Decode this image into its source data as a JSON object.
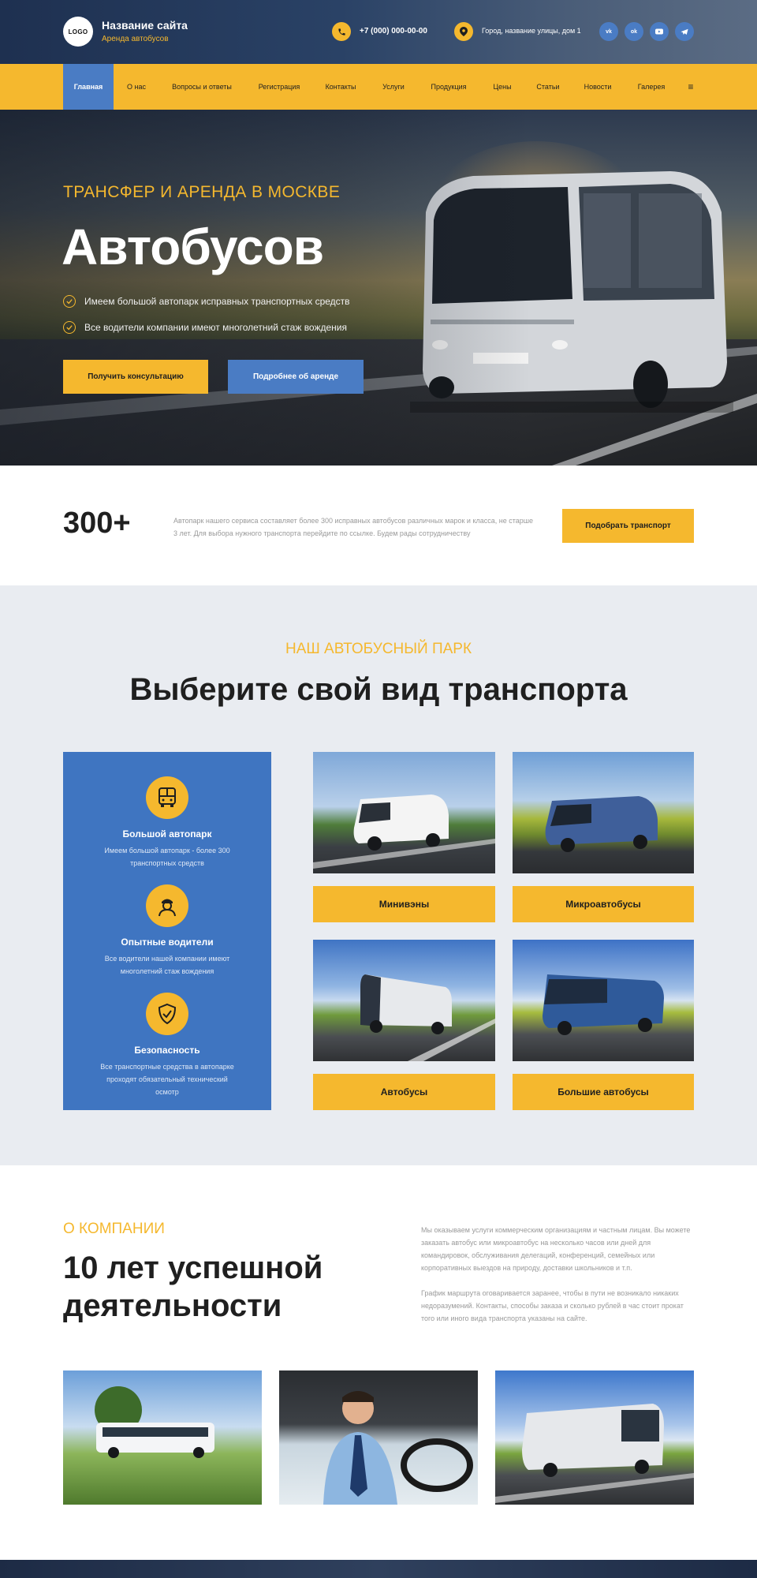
{
  "header": {
    "logo_text": "LOGO",
    "site_name": "Название сайта",
    "tagline": "Аренда автобусов",
    "phone": "+7 (000) 000-00-00",
    "address": "Город, название улицы, дом 1",
    "socials": [
      {
        "label": "vk",
        "icon": "vk-icon"
      },
      {
        "label": "ok",
        "icon": "odnoklassniki-icon"
      },
      {
        "label": "yt",
        "icon": "youtube-icon"
      },
      {
        "label": "tg",
        "icon": "telegram-icon"
      }
    ],
    "accent_color": "#f5b82e",
    "brand_blue": "#4a7cc4"
  },
  "nav": {
    "items": [
      {
        "label": "Главная",
        "active": true
      },
      {
        "label": "О нас"
      },
      {
        "label": "Вопросы и ответы"
      },
      {
        "label": "Регистрация"
      },
      {
        "label": "Контакты"
      },
      {
        "label": "Услуги"
      },
      {
        "label": "Продукция"
      },
      {
        "label": "Цены"
      },
      {
        "label": "Статьи"
      },
      {
        "label": "Новости"
      },
      {
        "label": "Галерея"
      },
      {
        "label": "≡"
      }
    ]
  },
  "hero": {
    "subtitle": "ТРАНСФЕР И АРЕНДА В МОСКВЕ",
    "title": "Автобусов",
    "checks": [
      "Имеем большой автопарк исправных транспортных средств",
      "Все водители компании имеют многолетний стаж вождения"
    ],
    "primary_button": "Получить консультацию",
    "secondary_button": "Подробнее об аренде"
  },
  "stats": {
    "number": "300+",
    "text": "Автопарк нашего сервиса составляет более 300 исправных автобусов различных марок и класса, не старше 3 лет. Для выбора нужного транспорта перейдите по ссылке. Будем рады сотрудничеству",
    "button": "Подобрать транспорт"
  },
  "fleet": {
    "kicker": "НАШ АВТОБУСНЫЙ ПАРК",
    "title": "Выберите свой вид транспорта",
    "features": [
      {
        "title": "Большой автопарк",
        "desc": "Имеем большой автопарк - более 300 транспортных средств",
        "icon": "bus-icon"
      },
      {
        "title": "Опытные водители",
        "desc": "Все водители нашей компании имеют многолетний стаж вождения",
        "icon": "driver-icon"
      },
      {
        "title": "Безопасность",
        "desc": "Все транспортные средства в автопарке проходят обязательный технический осмотр",
        "icon": "shield-check-icon"
      }
    ],
    "types": [
      {
        "label": "Минивэны"
      },
      {
        "label": "Микроавтобусы"
      },
      {
        "label": "Автобусы"
      },
      {
        "label": "Большие автобусы"
      }
    ]
  },
  "about": {
    "kicker": "О КОМПАНИИ",
    "title": "10 лет успешной деятельности",
    "paragraphs": [
      "Мы оказываем услуги коммерческим организациям и частным лицам. Вы можете заказать автобус или микроавтобус на несколько часов или дней для командировок, обслуживания делегаций, конференций, семейных или корпоративных выездов на природу, доставки школьников и т.п.",
      "График маршрута оговаривается заранее, чтобы в пути не возникало никаких недоразумений. Контакты, способы заказа и сколько рублей в час стоит прокат того или иного вида транспорта указаны на сайте."
    ]
  }
}
